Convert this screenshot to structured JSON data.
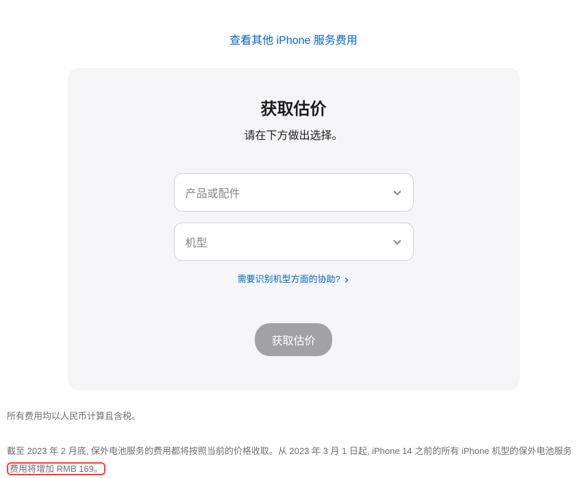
{
  "topLink": {
    "label": "查看其他 iPhone 服务费用"
  },
  "card": {
    "title": "获取估价",
    "subtitle": "请在下方做出选择。",
    "productSelect": {
      "placeholder": "产品或配件"
    },
    "modelSelect": {
      "placeholder": "机型"
    },
    "helpLink": {
      "label": "需要识别机型方面的协助?"
    },
    "submit": {
      "label": "获取估价"
    }
  },
  "footer": {
    "line1": "所有费用均以人民币计算且含税。",
    "line2_part1": "截至 2023 年 2 月底, 保外电池服务的费用都将按照当前的价格收取。从 2023 年 3 月 1 日起, iPhone 14 之前的所有 iPhone 机型的保外电池服务",
    "line2_highlight": "费用将增加 RMB 169。"
  }
}
